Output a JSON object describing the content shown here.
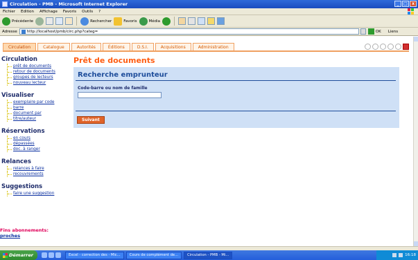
{
  "window": {
    "title": "Circulation - PMB - Microsoft Internet Explorer",
    "controls": [
      "_",
      "□",
      "x"
    ]
  },
  "menubar": [
    "Fichier",
    "Edition",
    "Affichage",
    "Favoris",
    "Outils",
    "?"
  ],
  "toolbar": {
    "back_label": "Précédente",
    "search_label": "Rechercher",
    "favorites_label": "Favoris",
    "media_label": "Média"
  },
  "address": {
    "label": "Adresse",
    "url": "http://localhost/pmb/circ.php?categ=",
    "go_label": "OK",
    "links_label": "Liens"
  },
  "tabs": [
    {
      "label": "Circulation",
      "active": true
    },
    {
      "label": "Catalogue",
      "active": false
    },
    {
      "label": "Autorités",
      "active": false
    },
    {
      "label": "Éditions",
      "active": false
    },
    {
      "label": "D.S.I.",
      "active": false
    },
    {
      "label": "Acquisitions",
      "active": false
    },
    {
      "label": "Administration",
      "active": false
    }
  ],
  "sidebar": {
    "circulation": {
      "title": "Circulation",
      "links": [
        "prêt de documents",
        "retour de documents",
        "groupes de lecteurs",
        "nouveau lecteur"
      ]
    },
    "visualiser": {
      "title": "Visualiser",
      "links": [
        "exemplaire par code",
        "barre",
        "document par",
        "titre/auteur"
      ]
    },
    "reservations": {
      "title": "Réservations",
      "links": [
        "en cours",
        "dépassées",
        "doc. à ranger"
      ]
    },
    "relances": {
      "title": "Relances",
      "links": [
        "relances à faire",
        "recouvrements"
      ]
    },
    "suggestions": {
      "title": "Suggestions",
      "links": [
        "faire une suggestion"
      ]
    },
    "fins": {
      "title": "Fins abonnements:",
      "link": "proches"
    }
  },
  "main": {
    "title": "Prêt de documents",
    "panel_title": "Recherche emprunteur",
    "field_label": "Code-barre ou nom de famille",
    "field_value": "",
    "submit_label": "Suivant"
  },
  "taskbar": {
    "start_label": "Démarrer",
    "tasks": [
      {
        "label": "Excel - correction des - Mic...",
        "active": false
      },
      {
        "label": "Cours de complément de...",
        "active": false
      },
      {
        "label": "Circulation - PMB - Mi...",
        "active": true
      }
    ],
    "clock": "16:18"
  },
  "colors": {
    "accent_orange": "#ff5d12",
    "panel_blue": "#cfe0f6",
    "link_blue": "#0a2fa0",
    "heading_navy": "#1d2b6a",
    "fins_magenta": "#e0005a"
  }
}
